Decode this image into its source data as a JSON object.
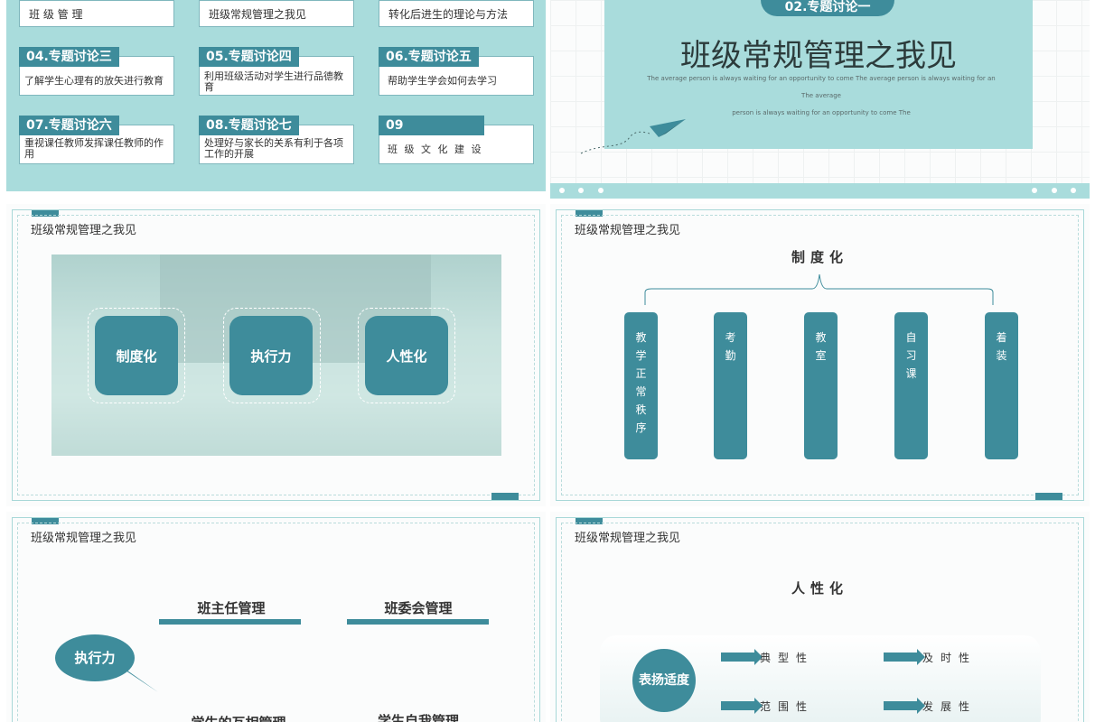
{
  "slide1": {
    "top_items": [
      {
        "text": "班 级 管 理"
      },
      {
        "text": "班级常规管理之我见"
      },
      {
        "text": "转化后进生的理论与方法"
      }
    ],
    "items": [
      {
        "label": "04.专题讨论三",
        "text": "了解学生心理有的放矢进行教育"
      },
      {
        "label": "05.专题讨论四",
        "text": "利用班级活动对学生进行品德教育"
      },
      {
        "label": "06.专题讨论五",
        "text": "帮助学生学会如何去学习"
      },
      {
        "label": "07.专题讨论六",
        "text": "重视课任教师发挥课任教师的作用"
      },
      {
        "label": "08.专题讨论七",
        "text": "处理好与家长的关系有利于各项工作的开展"
      },
      {
        "label": "09",
        "text": "班 级 文 化 建 设"
      }
    ]
  },
  "slide2": {
    "pill": "02.专题讨论一",
    "heading": "班级常规管理之我见",
    "sub_line1": "The average person is always waiting for an opportunity to come The average person is always waiting for an The average",
    "sub_line2": "person is always waiting for an opportunity to come The"
  },
  "slide3": {
    "title": "班级常规管理之我见",
    "cards": [
      "制度化",
      "执行力",
      "人性化"
    ]
  },
  "slide4": {
    "title": "班级常规管理之我见",
    "heading": "制度化",
    "columns": [
      "教学正常秩序",
      "考勤",
      "教室",
      "自习课",
      "着装"
    ]
  },
  "slide5": {
    "title": "班级常规管理之我见",
    "left_heading": "班主任管理",
    "right_heading": "班委会管理",
    "bubble": "执行力",
    "left_bottom": "学生的互相管理",
    "right_bottom": "学生自我管理"
  },
  "slide6": {
    "title": "班级常规管理之我见",
    "heading": "人性化",
    "circle": "表扬适度",
    "labels": [
      "典型性",
      "及时性",
      "范围性",
      "发展性"
    ]
  },
  "colors": {
    "accent": "#3e8c9b",
    "light_teal": "#a9dcdc"
  }
}
